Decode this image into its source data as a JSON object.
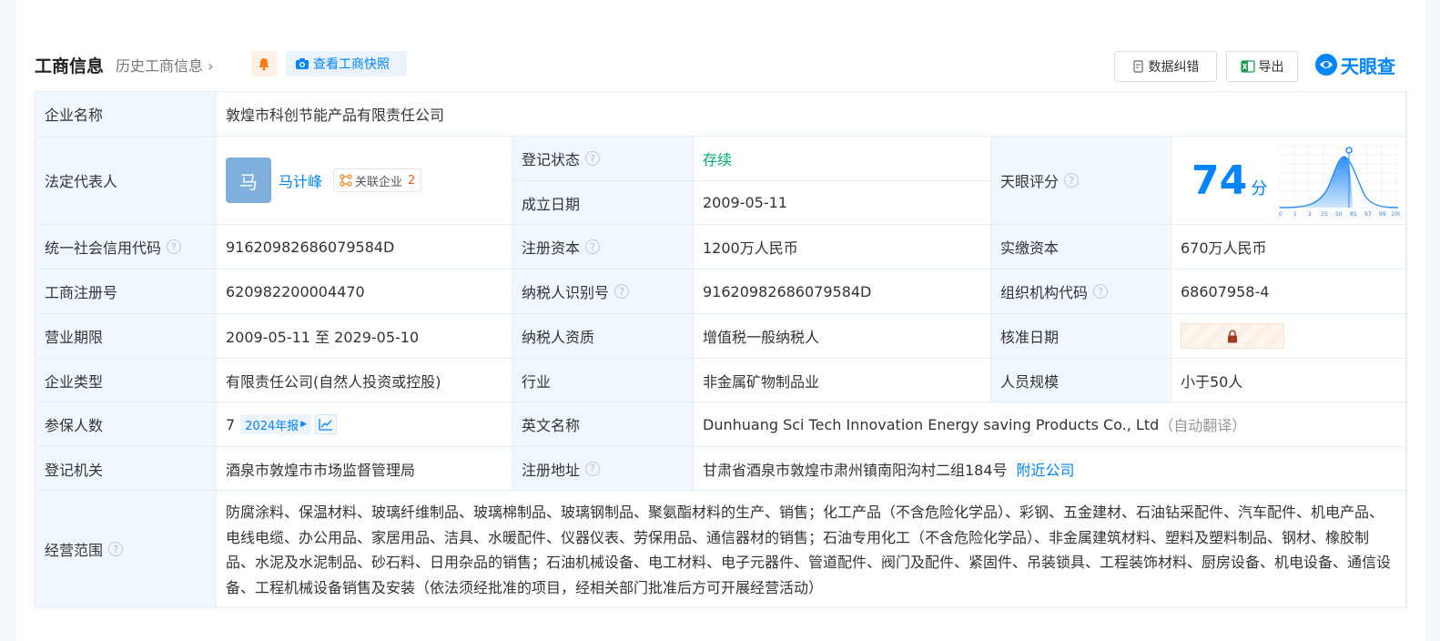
{
  "header": {
    "title": "工商信息",
    "history": "历史工商信息",
    "snapshot_label": "查看工商快照",
    "correct_label": "数据纠错",
    "export_label": "导出",
    "logo_text": "天眼查"
  },
  "colors": {
    "accent": "#0084ff",
    "label_bg": "#f0f7fe",
    "status_green": "#00a870"
  },
  "rows": {
    "company_name": {
      "label": "企业名称",
      "value": "敦煌市科创节能产品有限责任公司"
    },
    "legal_rep": {
      "label": "法定代表人",
      "avatar_char": "马",
      "name": "马计峰",
      "related_label": "关联企业",
      "related_count": "2"
    },
    "reg_status": {
      "label": "登记状态",
      "value": "存续"
    },
    "found_date": {
      "label": "成立日期",
      "value": "2009-05-11"
    },
    "tianyan_score": {
      "label": "天眼评分",
      "value": "74",
      "unit": "分",
      "ticks": [
        "0",
        "1",
        "3",
        "15",
        "50",
        "85",
        "97",
        "99",
        "100"
      ]
    },
    "credit_code": {
      "label": "统一社会信用代码",
      "value": "91620982686079584D"
    },
    "reg_capital": {
      "label": "注册资本",
      "value": "1200万人民币"
    },
    "paid_capital": {
      "label": "实缴资本",
      "value": "670万人民币"
    },
    "biz_reg_no": {
      "label": "工商注册号",
      "value": "620982200004470"
    },
    "taxpayer_id": {
      "label": "纳税人识别号",
      "value": "91620982686079584D"
    },
    "org_code": {
      "label": "组织机构代码",
      "value": "68607958-4"
    },
    "biz_term": {
      "label": "营业期限",
      "value": "2009-05-11 至 2029-05-10"
    },
    "taxpayer_type": {
      "label": "纳税人资质",
      "value": "增值税一般纳税人"
    },
    "approval_date": {
      "label": "核准日期"
    },
    "company_type": {
      "label": "企业类型",
      "value": "有限责任公司(自然人投资或控股)"
    },
    "industry": {
      "label": "行业",
      "value": "非金属矿物制品业"
    },
    "staff_size": {
      "label": "人员规模",
      "value": "小于50人"
    },
    "insured": {
      "label": "参保人数",
      "value": "7",
      "report_label": "2024年报"
    },
    "english_name": {
      "label": "英文名称",
      "value": "Dunhuang Sci Tech Innovation Energy saving Products Co., Ltd",
      "note": "（自动翻译）"
    },
    "reg_authority": {
      "label": "登记机关",
      "value": "酒泉市敦煌市市场监督管理局"
    },
    "reg_address": {
      "label": "注册地址",
      "value": "甘肃省酒泉市敦煌市肃州镇南阳沟村二组184号",
      "nearby_label": "附近公司"
    },
    "biz_scope": {
      "label": "经营范围",
      "value": "防腐涂料、保温材料、玻璃纤维制品、玻璃棉制品、玻璃钢制品、聚氨酯材料的生产、销售；化工产品（不含危险化学品）、彩钢、五金建材、石油钻采配件、汽车配件、机电产品、电线电缆、办公用品、家居用品、洁具、水暖配件、仪器仪表、劳保用品、通信器材的销售；石油专用化工（不含危险化学品）、非金属建筑材料、塑料及塑料制品、钢材、橡胶制品、水泥及水泥制品、砂石料、日用杂品的销售；石油机械设备、电工材料、电子元器件、管道配件、阀门及配件、紧固件、吊装锁具、工程装饰材料、厨房设备、机电设备、通信设备、工程机械设备销售及安装（依法须经批准的项目，经相关部门批准后方可开展经营活动）"
    }
  }
}
